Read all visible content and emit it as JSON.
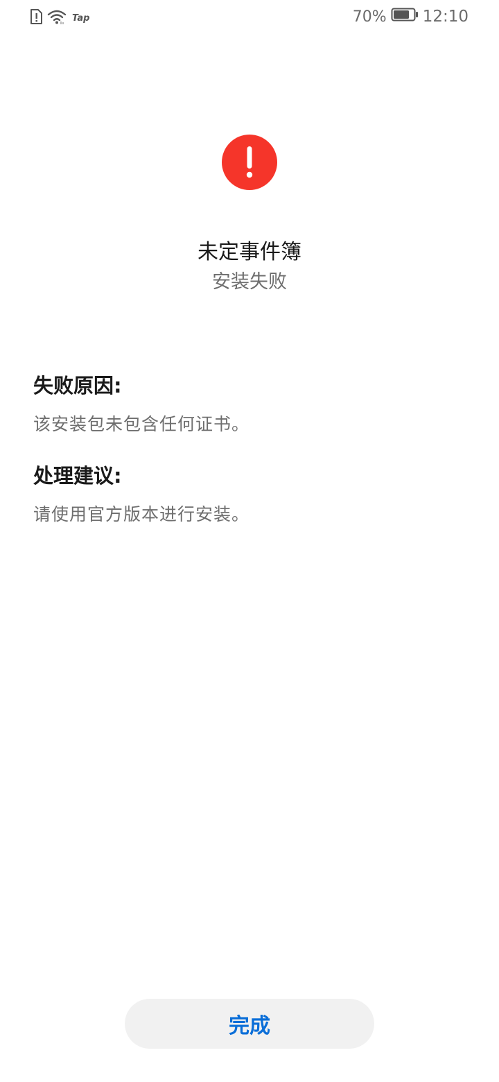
{
  "status_bar": {
    "left_icons": [
      "sim-alert-icon",
      "wifi-icon"
    ],
    "tap_label": "Tap",
    "battery_percent": "70%",
    "time": "12:10"
  },
  "result": {
    "icon": "exclamation-icon",
    "icon_color": "#f5352a",
    "app_name": "未定事件簿",
    "status": "安装失败"
  },
  "failure": {
    "heading": "失败原因:",
    "text": "该安装包未包含任何证书。"
  },
  "suggestion": {
    "heading": "处理建议:",
    "text": "请使用官方版本进行安装。"
  },
  "actions": {
    "done_label": "完成",
    "accent_color": "#0a6ed8"
  }
}
